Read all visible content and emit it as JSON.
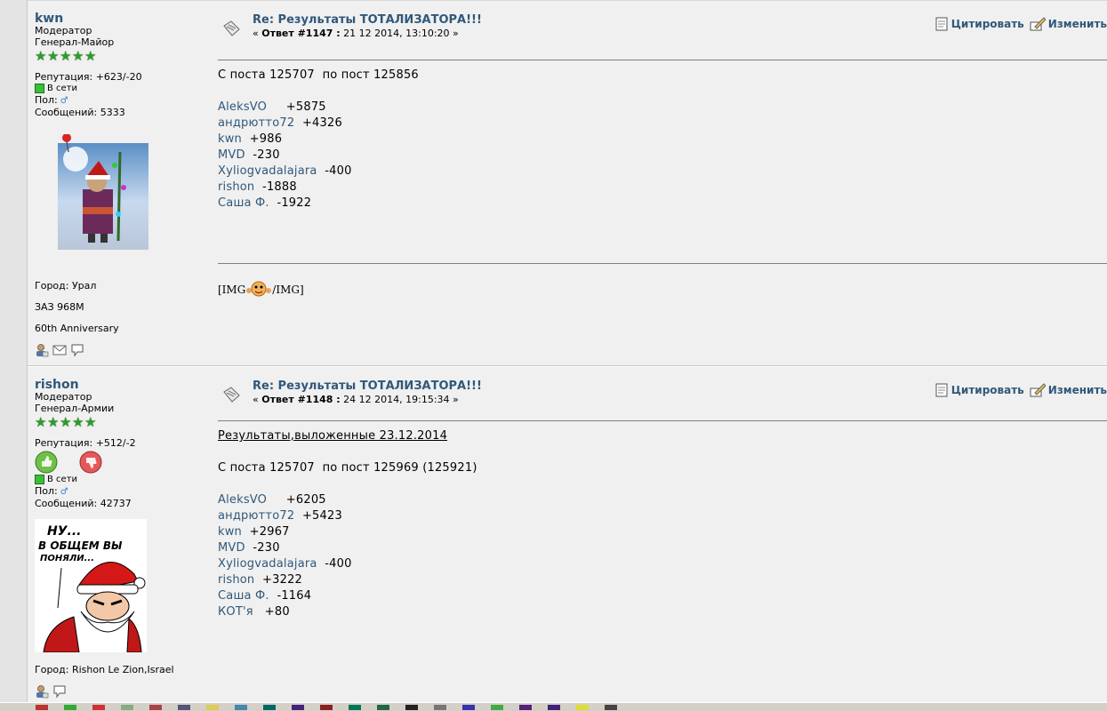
{
  "posts": [
    {
      "author": "kwn",
      "role": "Модератор",
      "rank": "Генерал-Майор",
      "stars": 5,
      "reputation": "Репутация: +623/-20",
      "status": "В сети",
      "gender_label": "Пол:",
      "messages": "Сообщений: 5333",
      "city": "Город: Урал",
      "car": "ЗАЗ 968М",
      "anniversary": "60th Anniversary",
      "subject": "Re: Результаты ТОТАЛИЗАТОРА!!!",
      "reply_prefix": "«",
      "reply_no": "Ответ #1147 :",
      "reply_date": "21 12 2014, 13:10:20 »",
      "quote_label": "Цитировать",
      "edit_label": "Изменить",
      "intro": "С поста 125707  по пост 125856",
      "scores": [
        {
          "name": "AleksVO",
          "score": "+5875",
          "pad": "     "
        },
        {
          "name": "андрютто72",
          "score": "+4326",
          "pad": "  "
        },
        {
          "name": "kwn",
          "score": "+986",
          "pad": "  "
        },
        {
          "name": "MVD",
          "score": "-230",
          "pad": "  "
        },
        {
          "name": "Xyliogvadalajara",
          "score": "-400",
          "pad": "  "
        },
        {
          "name": "rishon",
          "score": "-1888",
          "pad": "  "
        },
        {
          "name": "Саша Ф.",
          "score": "-1922",
          "pad": "  "
        }
      ],
      "signature": "[IMG",
      "signature_end": "/IMG]"
    },
    {
      "author": "rishon",
      "role": "Модератор",
      "rank": "Генерал-Армии",
      "stars": 5,
      "reputation": "Репутация: +512/-2",
      "status": "В сети",
      "gender_label": "Пол:",
      "messages": "Сообщений: 42737",
      "city": "Город: Rishon Le Zion,Israel",
      "avatar_text1": "НУ...",
      "avatar_text2": "В ОБЩЕМ ВЫ",
      "avatar_text3": "ПОНЯЛИ...",
      "subject": "Re: Результаты ТОТАЛИЗАТОРА!!!",
      "reply_prefix": "«",
      "reply_no": "Ответ #1148 :",
      "reply_date": "24 12 2014, 19:15:34 »",
      "quote_label": "Цитировать",
      "edit_label": "Изменить",
      "heading": "Результаты,выложенные 23.12.2014",
      "intro": "С поста 125707  по пост 125969 (125921)",
      "scores": [
        {
          "name": "AleksVO",
          "score": "+6205",
          "pad": "     "
        },
        {
          "name": "андрютто72",
          "score": "+5423",
          "pad": "  "
        },
        {
          "name": "kwn",
          "score": "+2967",
          "pad": "  "
        },
        {
          "name": "MVD",
          "score": "-230",
          "pad": "  "
        },
        {
          "name": "Xyliogvadalajara",
          "score": "-400",
          "pad": "  "
        },
        {
          "name": "rishon",
          "score": "+3222",
          "pad": "  "
        },
        {
          "name": "Саша Ф.",
          "score": "-1164",
          "pad": "  "
        },
        {
          "name": "КОТ'я",
          "score": "+80",
          "pad": "   "
        }
      ]
    }
  ],
  "colors": {
    "link": "#30587a",
    "background": "#f0f0f0",
    "star": "#2e9b2e"
  }
}
